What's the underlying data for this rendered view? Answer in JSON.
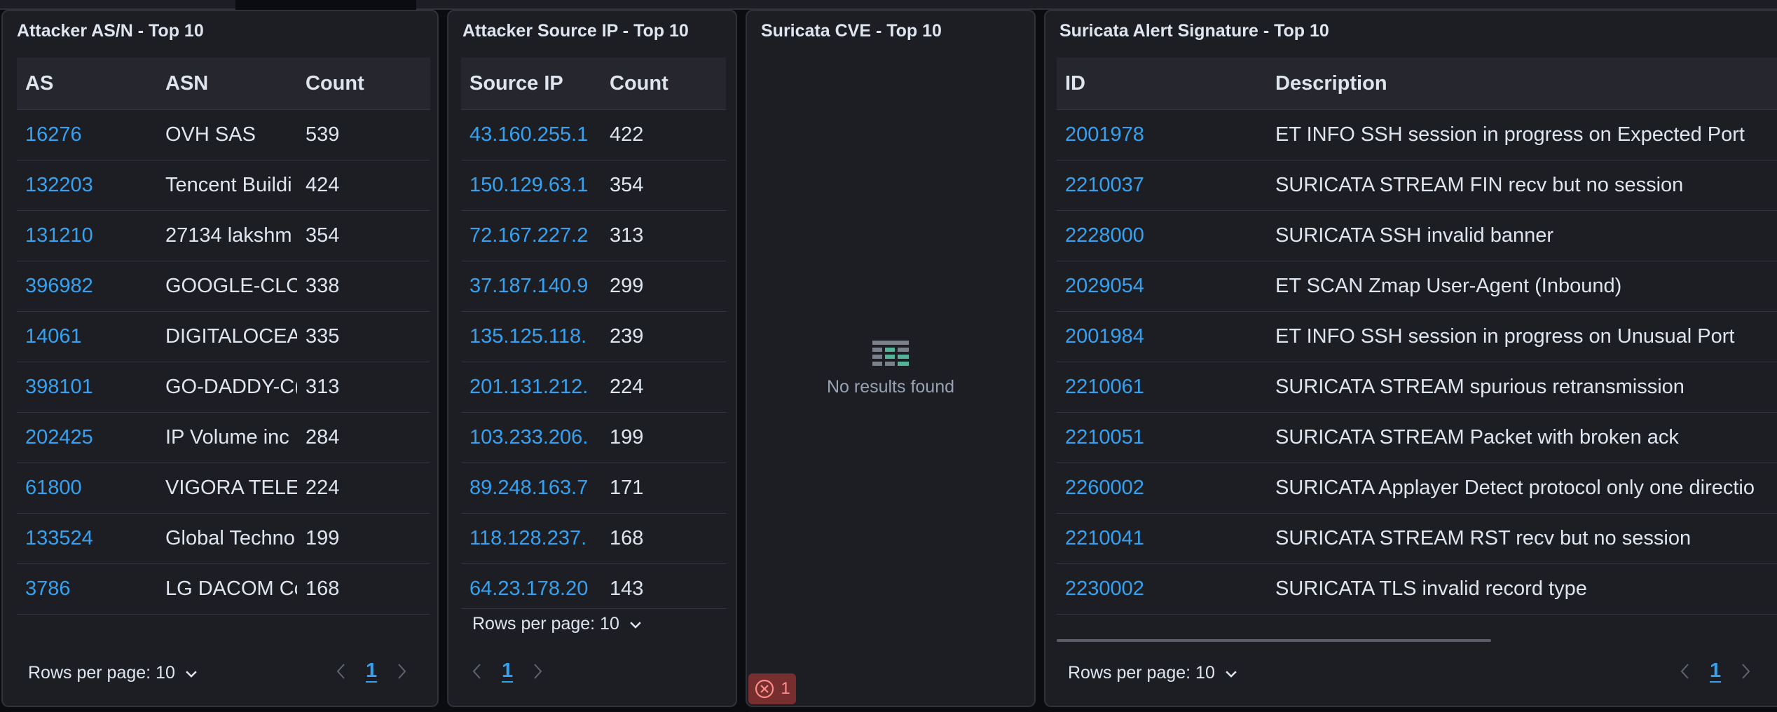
{
  "panels": {
    "asn": {
      "title": "Attacker AS/N - Top 10",
      "columns": [
        "AS",
        "ASN",
        "Count"
      ],
      "rows": [
        {
          "as": "16276",
          "asn": "OVH SAS",
          "count": "539"
        },
        {
          "as": "132203",
          "asn": "Tencent Buildi",
          "count": "424"
        },
        {
          "as": "131210",
          "asn": "27134 lakshm",
          "count": "354"
        },
        {
          "as": "396982",
          "asn": "GOOGLE-CLO",
          "count": "338"
        },
        {
          "as": "14061",
          "asn": "DIGITALOCEAI",
          "count": "335"
        },
        {
          "as": "398101",
          "asn": "GO-DADDY-C(",
          "count": "313"
        },
        {
          "as": "202425",
          "asn": "IP Volume inc",
          "count": "284"
        },
        {
          "as": "61800",
          "asn": "VIGORA TELE(",
          "count": "224"
        },
        {
          "as": "133524",
          "asn": "Global Techno",
          "count": "199"
        },
        {
          "as": "3786",
          "asn": "LG DACOM Cc",
          "count": "168"
        }
      ],
      "rows_per_page": "Rows per page: 10",
      "page": "1"
    },
    "source_ip": {
      "title": "Attacker Source IP - Top 10",
      "columns": [
        "Source IP",
        "Count"
      ],
      "rows": [
        {
          "ip": "43.160.255.1",
          "count": "422"
        },
        {
          "ip": "150.129.63.1",
          "count": "354"
        },
        {
          "ip": "72.167.227.2",
          "count": "313"
        },
        {
          "ip": "37.187.140.9",
          "count": "299"
        },
        {
          "ip": "135.125.118.",
          "count": "239"
        },
        {
          "ip": "201.131.212.",
          "count": "224"
        },
        {
          "ip": "103.233.206.",
          "count": "199"
        },
        {
          "ip": "89.248.163.7",
          "count": "171"
        },
        {
          "ip": "118.128.237.",
          "count": "168"
        },
        {
          "ip": "64.23.178.20",
          "count": "143"
        }
      ],
      "rows_per_page": "Rows per page: 10",
      "page": "1"
    },
    "cve": {
      "title": "Suricata CVE - Top 10",
      "empty_text": "No results found",
      "error_count": "1"
    },
    "signature": {
      "title": "Suricata Alert Signature - Top 10",
      "columns": [
        "ID",
        "Description"
      ],
      "rows": [
        {
          "id": "2001978",
          "desc": "ET INFO SSH session in progress on Expected Port"
        },
        {
          "id": "2210037",
          "desc": "SURICATA STREAM FIN recv but no session"
        },
        {
          "id": "2228000",
          "desc": "SURICATA SSH invalid banner"
        },
        {
          "id": "2029054",
          "desc": "ET SCAN Zmap User-Agent (Inbound)"
        },
        {
          "id": "2001984",
          "desc": "ET INFO SSH session in progress on Unusual Port"
        },
        {
          "id": "2210061",
          "desc": "SURICATA STREAM spurious retransmission"
        },
        {
          "id": "2210051",
          "desc": "SURICATA STREAM Packet with broken ack"
        },
        {
          "id": "2260002",
          "desc": "SURICATA Applayer Detect protocol only one directio"
        },
        {
          "id": "2210041",
          "desc": "SURICATA STREAM RST recv but no session"
        },
        {
          "id": "2230002",
          "desc": "SURICATA TLS invalid record type"
        }
      ],
      "rows_per_page": "Rows per page: 10",
      "page": "1"
    }
  },
  "colors": {
    "panel_bg": "#1d1e24",
    "link": "#36a2ef",
    "text": "#dfe5ef",
    "muted": "#98a2b3",
    "error_bg": "#772e2e",
    "error_fg": "#ff8a8a",
    "empty_icon_accent": "#54b399"
  },
  "icons": {
    "rows_per_page": "chevron-down-icon",
    "prev_page": "chevron-left-icon",
    "next_page": "chevron-right-icon",
    "empty": "table-icon",
    "error": "error-circle-icon"
  }
}
